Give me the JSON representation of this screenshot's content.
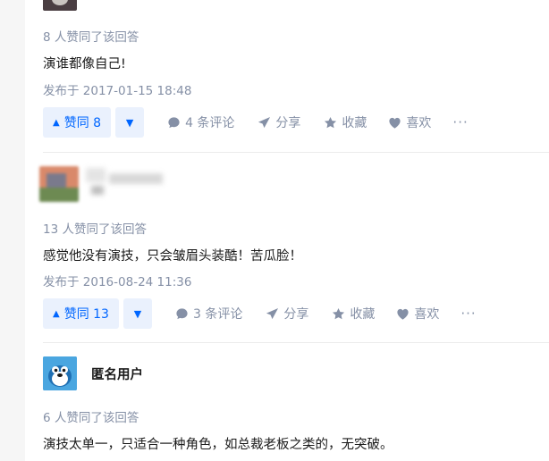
{
  "answers": [
    {
      "votes_text": "8 人赞同了该回答",
      "content": "演谁都像自己!",
      "date": "发布于 2017-01-15 18:48",
      "actions": {
        "upvote": "赞同 8",
        "comments": "4 条评论",
        "share": "分享",
        "collect": "收藏",
        "like": "喜欢",
        "more": "···"
      }
    },
    {
      "author": "",
      "votes_text": "13 人赞同了该回答",
      "content": "感觉他没有演技，只会皱眉头装酷！苦瓜脸！",
      "date": "发布于 2016-08-24 11:36",
      "actions": {
        "upvote": "赞同 13",
        "comments": "3 条评论",
        "share": "分享",
        "collect": "收藏",
        "like": "喜欢",
        "more": "···"
      }
    },
    {
      "author": "匿名用户",
      "votes_text": "6 人赞同了该回答",
      "content": "演技太单一，只适合一种角色，如总裁老板之类的，无突破。"
    }
  ],
  "colors": {
    "accent": "#0066ff",
    "vote_bg": "#eaf1fd",
    "meta": "#8590a6",
    "divider": "#ebebeb"
  }
}
